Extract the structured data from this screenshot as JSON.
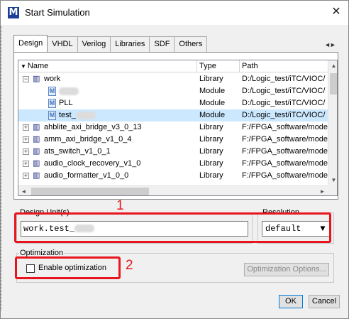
{
  "window": {
    "title": "Start Simulation",
    "close_glyph": "✕",
    "app_icon_glyph": "M"
  },
  "tabs": [
    {
      "label": "Design",
      "active": true
    },
    {
      "label": "VHDL"
    },
    {
      "label": "Verilog"
    },
    {
      "label": "Libraries"
    },
    {
      "label": "SDF"
    },
    {
      "label": "Others"
    }
  ],
  "tab_scroll_glyph": "◄►",
  "tree": {
    "columns": {
      "name": "Name",
      "type": "Type",
      "path": "Path"
    },
    "rows": [
      {
        "name": "work",
        "type": "Library",
        "path": "D:/Logic_test/iTC/VIOC/",
        "kind": "library",
        "expander": "−",
        "level": 0
      },
      {
        "name": "",
        "type": "Module",
        "path": "D:/Logic_test/iTC/VIOC/",
        "kind": "module",
        "level": 1,
        "redacted": true
      },
      {
        "name": "PLL",
        "type": "Module",
        "path": "D:/Logic_test/iTC/VIOC/",
        "kind": "module",
        "level": 1
      },
      {
        "name": "test_",
        "type": "Module",
        "path": "D:/Logic_test/iTC/VIOC/",
        "kind": "module",
        "level": 1,
        "selected": true,
        "redacted": true
      },
      {
        "name": "ahblite_axi_bridge_v3_0_13",
        "type": "Library",
        "path": "F:/FPGA_software/mode",
        "kind": "library",
        "expander": "+",
        "level": 0
      },
      {
        "name": "amm_axi_bridge_v1_0_4",
        "type": "Library",
        "path": "F:/FPGA_software/mode",
        "kind": "library",
        "expander": "+",
        "level": 0
      },
      {
        "name": "ats_switch_v1_0_1",
        "type": "Library",
        "path": "F:/FPGA_software/mode",
        "kind": "library",
        "expander": "+",
        "level": 0
      },
      {
        "name": "audio_clock_recovery_v1_0",
        "type": "Library",
        "path": "F:/FPGA_software/mode",
        "kind": "library",
        "expander": "+",
        "level": 0
      },
      {
        "name": "audio_formatter_v1_0_0",
        "type": "Library",
        "path": "F:/FPGA_software/mode",
        "kind": "library",
        "expander": "+",
        "level": 0
      }
    ]
  },
  "design_unit": {
    "label": "Design Unit(s)",
    "value": "work.test_"
  },
  "resolution": {
    "label": "Resolution",
    "value": "default"
  },
  "optimization": {
    "label": "Optimization",
    "checkbox_label": "Enable optimization",
    "checked": false,
    "options_button": "Optimization Options..."
  },
  "annotations": {
    "marker1": "1",
    "marker2": "2",
    "color": "#e8151e"
  },
  "footer": {
    "ok": "OK",
    "cancel": "Cancel"
  }
}
